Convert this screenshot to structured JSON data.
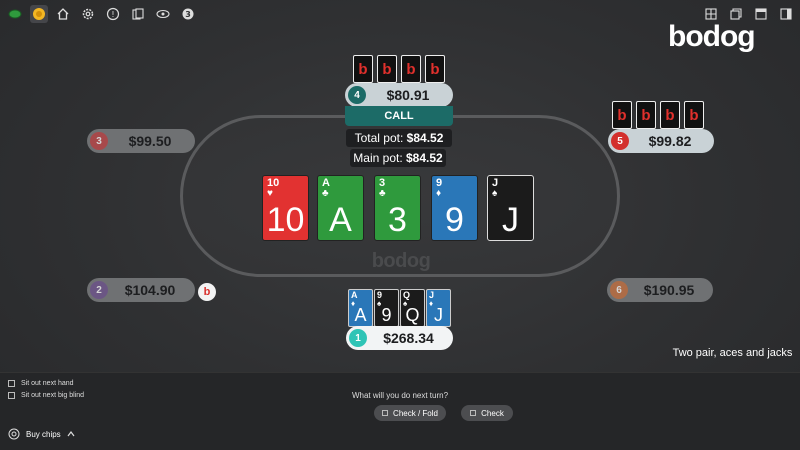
{
  "toolbar": {
    "icons": [
      "tables-icon",
      "chips-icon",
      "home-icon",
      "settings-icon",
      "help-icon",
      "cards-icon",
      "view-icon",
      "sound-icon"
    ],
    "right_icons": [
      "grid-layout-icon",
      "cascade-icon",
      "tile-icon",
      "sidebar-icon"
    ]
  },
  "brand": {
    "logo": "bodog",
    "table_logo": "bodog"
  },
  "seats": {
    "s4": {
      "num": "4",
      "amount": "$80.91",
      "color": "#1c6b67"
    },
    "s3": {
      "num": "3",
      "amount": "$99.50",
      "color": "#c0393b"
    },
    "s5": {
      "num": "5",
      "amount": "$99.82",
      "color": "#d3302d"
    },
    "s2": {
      "num": "2",
      "amount": "$104.90",
      "color": "#6a4c8c"
    },
    "s6": {
      "num": "6",
      "amount": "$190.95",
      "color": "#c86b35"
    },
    "s1": {
      "num": "1",
      "amount": "$268.34",
      "color": "#2ec4b6"
    }
  },
  "action": {
    "last_action": "CALL"
  },
  "pot": {
    "total_label": "Total pot:",
    "total": "$84.52",
    "main_label": "Main pot:",
    "main": "$84.52"
  },
  "board": [
    {
      "rank": "10",
      "suit": "♥",
      "color": "red"
    },
    {
      "rank": "A",
      "suit": "♣",
      "color": "green"
    },
    {
      "rank": "3",
      "suit": "♣",
      "color": "green"
    },
    {
      "rank": "9",
      "suit": "♦",
      "color": "blue"
    },
    {
      "rank": "J",
      "suit": "♠",
      "color": "black"
    }
  ],
  "hero_cards": [
    {
      "rank": "A",
      "suit": "♦",
      "color": "blue"
    },
    {
      "rank": "9",
      "suit": "♠",
      "color": "black"
    },
    {
      "rank": "Q",
      "suit": "♠",
      "color": "black"
    },
    {
      "rank": "J",
      "suit": "♦",
      "color": "blue"
    }
  ],
  "opponent_card_back": "b",
  "dealer_button": "b",
  "hand_description": "Two pair, aces and jacks",
  "options": {
    "sit_out_next_hand": "Sit out next hand",
    "sit_out_next_big_blind": "Sit out next big blind"
  },
  "next_turn": {
    "question": "What will you do next turn?",
    "check_fold": "Check / Fold",
    "check": "Check"
  },
  "buy_chips": "Buy chips"
}
